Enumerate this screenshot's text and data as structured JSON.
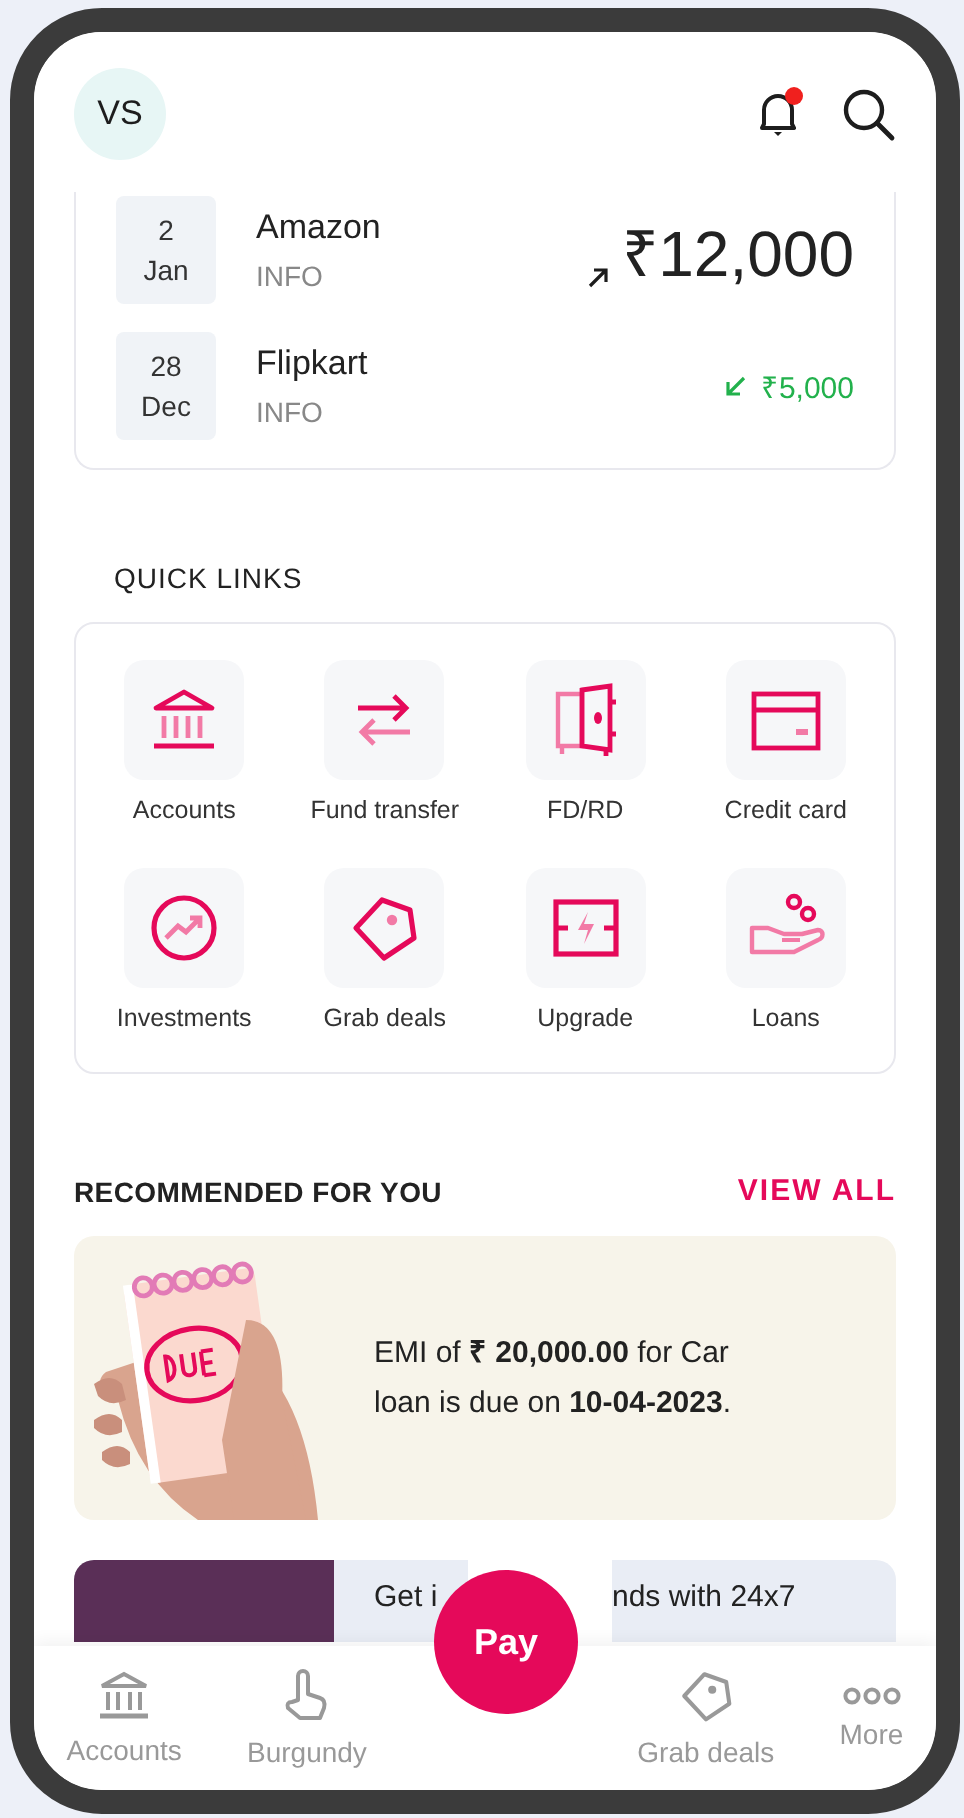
{
  "header": {
    "avatar_initials": "VS",
    "notifications_unread": true
  },
  "transactions": [
    {
      "day": "2",
      "month": "Jan",
      "merchant": "Amazon",
      "subtitle": "INFO",
      "amount": "₹12,000",
      "kind": "outgoing"
    },
    {
      "day": "28",
      "month": "Dec",
      "merchant": "Flipkart",
      "subtitle": "INFO",
      "amount": "₹5,000",
      "kind": "incoming"
    }
  ],
  "quick_links": {
    "title": "QUICK LINKS",
    "items": [
      {
        "label": "Accounts"
      },
      {
        "label": "Fund transfer"
      },
      {
        "label": "FD/RD"
      },
      {
        "label": "Credit card"
      },
      {
        "label": "Investments"
      },
      {
        "label": "Grab deals"
      },
      {
        "label": "Upgrade"
      },
      {
        "label": "Loans"
      }
    ]
  },
  "recommended": {
    "title": "RECOMMENDED FOR YOU",
    "view_all": "VIEW ALL",
    "cards": [
      {
        "kind": "emi",
        "text": "EMI of **₹ 20,000.00** for Car loan is due on **10-04-2023**."
      },
      {
        "kind": "promo",
        "fragments": [
          "Get i",
          "nds with 24x7"
        ]
      }
    ]
  },
  "pay_button": "Pay",
  "bottom_nav": [
    {
      "label": "Accounts",
      "selected": false
    },
    {
      "label": "Burgundy",
      "selected": false
    },
    {
      "label": "Grab deals",
      "selected": false
    },
    {
      "label": "More",
      "selected": false
    }
  ]
}
